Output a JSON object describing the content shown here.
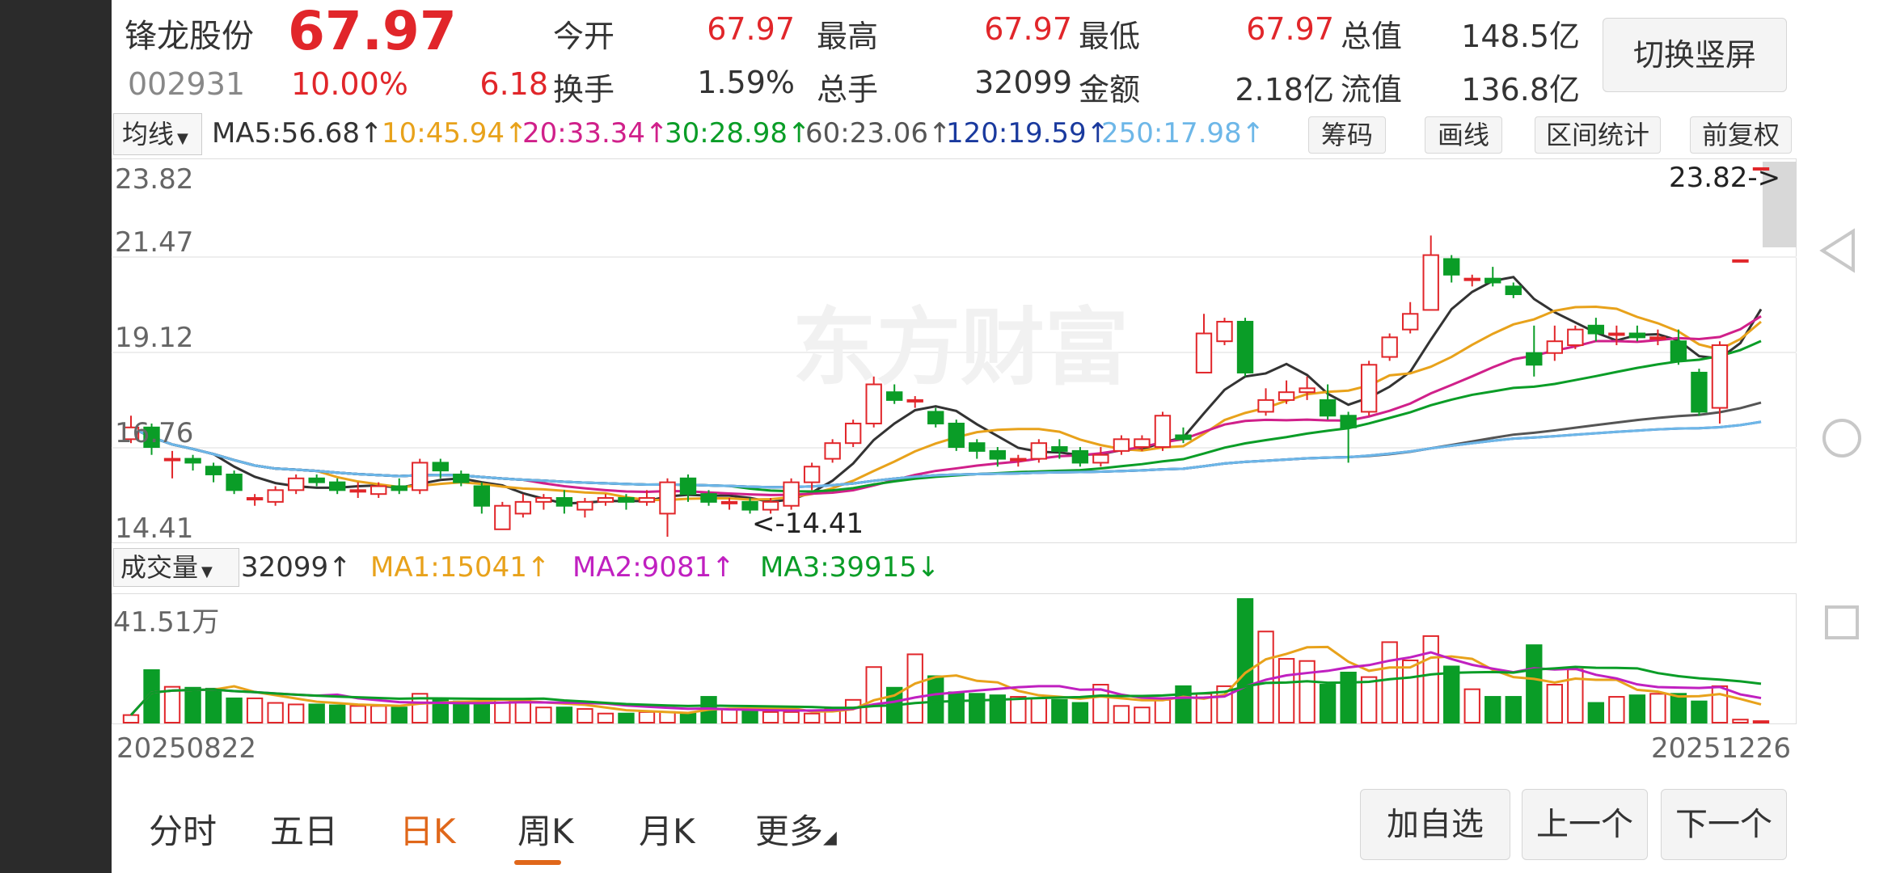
{
  "stock": {
    "name": "锋龙股份",
    "price": "67.97",
    "code": "002931",
    "change_pct": "10.00%",
    "change_amt": "6.18"
  },
  "stats": [
    {
      "label": "今开",
      "value": "67.97"
    },
    {
      "label": "最高",
      "value": "67.97"
    },
    {
      "label": "最低",
      "value": "67.97"
    },
    {
      "label": "总值",
      "value": "148.5亿"
    },
    {
      "label": "换手",
      "value": "1.59%"
    },
    {
      "label": "总手",
      "value": "32099"
    },
    {
      "label": "金额",
      "value": "2.18亿"
    },
    {
      "label": "流值",
      "value": "136.8亿"
    }
  ],
  "orientation_button": "切换竖屏",
  "ma_selector": "均线",
  "ma_legend": [
    {
      "text": "MA5:56.68↑",
      "color": "#333333"
    },
    {
      "text": "10:45.94↑",
      "color": "#e8a21b"
    },
    {
      "text": "20:33.34↑",
      "color": "#d0208a"
    },
    {
      "text": "30:28.98↑",
      "color": "#0a9d27"
    },
    {
      "text": "60:23.06↑",
      "color": "#555555"
    },
    {
      "text": "120:19.59↑",
      "color": "#1a3a9e"
    },
    {
      "text": "250:17.98↑",
      "color": "#6db7e8"
    }
  ],
  "tools": [
    "筹码",
    "画线",
    "区间统计",
    "前复权"
  ],
  "price_axis": [
    "23.82",
    "21.47",
    "19.12",
    "16.76",
    "14.41"
  ],
  "max_marker": "23.82->",
  "min_marker": "<-14.41",
  "watermark": "东方财富",
  "volume_selector": "成交量",
  "volume_legend": [
    {
      "text": "32099↑",
      "color": "#333333"
    },
    {
      "text": "MA1:15041↑",
      "color": "#e8a21b"
    },
    {
      "text": "MA2:9081↑",
      "color": "#c020c0"
    },
    {
      "text": "MA3:39915↓",
      "color": "#0a9d27"
    }
  ],
  "volume_axis_max": "41.51万",
  "date_start": "20250822",
  "date_end": "20251226",
  "tabs": [
    "分时",
    "五日",
    "日K",
    "周K",
    "月K",
    "更多"
  ],
  "active_tab": "日K",
  "actions": [
    "加自选",
    "上一个",
    "下一个"
  ],
  "colors": {
    "up": "#e1262a",
    "down": "#0a9d27",
    "accent": "#e0671a"
  },
  "chart_data": {
    "type": "candlestick",
    "ylim": [
      14.41,
      23.82
    ],
    "candles": [
      {
        "o": 16.9,
        "c": 17.2,
        "h": 17.5,
        "l": 16.8
      },
      {
        "o": 17.2,
        "c": 16.7,
        "h": 17.3,
        "l": 16.5
      },
      {
        "o": 16.4,
        "c": 16.4,
        "h": 16.6,
        "l": 15.9
      },
      {
        "o": 16.4,
        "c": 16.3,
        "h": 16.5,
        "l": 16.1
      },
      {
        "o": 16.2,
        "c": 16.0,
        "h": 16.3,
        "l": 15.8
      },
      {
        "o": 16.0,
        "c": 15.6,
        "h": 16.1,
        "l": 15.5
      },
      {
        "o": 15.4,
        "c": 15.4,
        "h": 15.5,
        "l": 15.2
      },
      {
        "o": 15.3,
        "c": 15.6,
        "h": 15.7,
        "l": 15.2
      },
      {
        "o": 15.6,
        "c": 15.9,
        "h": 16.0,
        "l": 15.5
      },
      {
        "o": 15.9,
        "c": 15.8,
        "h": 16.0,
        "l": 15.7
      },
      {
        "o": 15.8,
        "c": 15.6,
        "h": 15.9,
        "l": 15.5
      },
      {
        "o": 15.6,
        "c": 15.6,
        "h": 15.8,
        "l": 15.4
      },
      {
        "o": 15.5,
        "c": 15.7,
        "h": 15.8,
        "l": 15.4
      },
      {
        "o": 15.7,
        "c": 15.6,
        "h": 15.9,
        "l": 15.5
      },
      {
        "o": 15.6,
        "c": 16.3,
        "h": 16.4,
        "l": 15.5
      },
      {
        "o": 16.3,
        "c": 16.1,
        "h": 16.4,
        "l": 15.9
      },
      {
        "o": 16.0,
        "c": 15.8,
        "h": 16.1,
        "l": 15.7
      },
      {
        "o": 15.7,
        "c": 15.2,
        "h": 15.8,
        "l": 15.0
      },
      {
        "o": 14.6,
        "c": 15.2,
        "h": 15.3,
        "l": 14.6
      },
      {
        "o": 15.0,
        "c": 15.3,
        "h": 15.5,
        "l": 14.9
      },
      {
        "o": 15.3,
        "c": 15.4,
        "h": 15.5,
        "l": 15.1
      },
      {
        "o": 15.4,
        "c": 15.2,
        "h": 15.6,
        "l": 15.0
      },
      {
        "o": 15.1,
        "c": 15.3,
        "h": 15.4,
        "l": 14.9
      },
      {
        "o": 15.3,
        "c": 15.4,
        "h": 15.5,
        "l": 15.2
      },
      {
        "o": 15.4,
        "c": 15.3,
        "h": 15.5,
        "l": 15.1
      },
      {
        "o": 15.3,
        "c": 15.4,
        "h": 15.6,
        "l": 15.2
      },
      {
        "o": 15.0,
        "c": 15.8,
        "h": 15.9,
        "l": 14.41
      },
      {
        "o": 15.9,
        "c": 15.5,
        "h": 16.0,
        "l": 15.3
      },
      {
        "o": 15.5,
        "c": 15.3,
        "h": 15.6,
        "l": 15.2
      },
      {
        "o": 15.3,
        "c": 15.3,
        "h": 15.4,
        "l": 15.1
      },
      {
        "o": 15.3,
        "c": 15.1,
        "h": 15.4,
        "l": 15.0
      },
      {
        "o": 15.1,
        "c": 15.3,
        "h": 15.4,
        "l": 15.0
      },
      {
        "o": 15.2,
        "c": 15.8,
        "h": 15.9,
        "l": 15.1
      },
      {
        "o": 15.8,
        "c": 16.2,
        "h": 16.3,
        "l": 15.6
      },
      {
        "o": 16.4,
        "c": 16.8,
        "h": 16.9,
        "l": 16.3
      },
      {
        "o": 16.8,
        "c": 17.3,
        "h": 17.4,
        "l": 16.7
      },
      {
        "o": 17.3,
        "c": 18.3,
        "h": 18.5,
        "l": 17.2
      },
      {
        "o": 18.1,
        "c": 17.9,
        "h": 18.3,
        "l": 17.8
      },
      {
        "o": 17.9,
        "c": 17.9,
        "h": 18.0,
        "l": 17.7
      },
      {
        "o": 17.6,
        "c": 17.3,
        "h": 17.7,
        "l": 17.2
      },
      {
        "o": 17.3,
        "c": 16.7,
        "h": 17.4,
        "l": 16.6
      },
      {
        "o": 16.8,
        "c": 16.6,
        "h": 16.9,
        "l": 16.4
      },
      {
        "o": 16.6,
        "c": 16.4,
        "h": 16.7,
        "l": 16.2
      },
      {
        "o": 16.4,
        "c": 16.4,
        "h": 16.5,
        "l": 16.2
      },
      {
        "o": 16.4,
        "c": 16.8,
        "h": 16.9,
        "l": 16.3
      },
      {
        "o": 16.7,
        "c": 16.6,
        "h": 16.9,
        "l": 16.4
      },
      {
        "o": 16.6,
        "c": 16.3,
        "h": 16.7,
        "l": 16.2
      },
      {
        "o": 16.3,
        "c": 16.5,
        "h": 16.7,
        "l": 16.2
      },
      {
        "o": 16.6,
        "c": 16.9,
        "h": 17.0,
        "l": 16.5
      },
      {
        "o": 16.7,
        "c": 16.9,
        "h": 17.0,
        "l": 16.6
      },
      {
        "o": 16.7,
        "c": 17.5,
        "h": 17.6,
        "l": 16.6
      },
      {
        "o": 17.0,
        "c": 16.9,
        "h": 17.2,
        "l": 16.8
      },
      {
        "o": 18.6,
        "c": 19.6,
        "h": 20.1,
        "l": 18.6
      },
      {
        "o": 19.4,
        "c": 19.9,
        "h": 20.0,
        "l": 19.3
      },
      {
        "o": 19.9,
        "c": 18.6,
        "h": 20.0,
        "l": 18.5
      },
      {
        "o": 17.6,
        "c": 17.9,
        "h": 18.2,
        "l": 17.5
      },
      {
        "o": 17.9,
        "c": 18.1,
        "h": 18.4,
        "l": 17.8
      },
      {
        "o": 18.1,
        "c": 18.2,
        "h": 18.5,
        "l": 17.9
      },
      {
        "o": 17.9,
        "c": 17.5,
        "h": 18.3,
        "l": 17.4
      },
      {
        "o": 17.5,
        "c": 17.2,
        "h": 17.6,
        "l": 16.3
      },
      {
        "o": 17.6,
        "c": 18.8,
        "h": 18.9,
        "l": 17.5
      },
      {
        "o": 19.0,
        "c": 19.5,
        "h": 19.6,
        "l": 18.9
      },
      {
        "o": 19.7,
        "c": 20.1,
        "h": 20.4,
        "l": 19.6
      },
      {
        "o": 20.2,
        "c": 21.6,
        "h": 22.1,
        "l": 20.2
      },
      {
        "o": 21.5,
        "c": 21.1,
        "h": 21.6,
        "l": 20.9
      },
      {
        "o": 21.0,
        "c": 21.0,
        "h": 21.1,
        "l": 20.8
      },
      {
        "o": 21.0,
        "c": 20.9,
        "h": 21.3,
        "l": 20.8
      },
      {
        "o": 20.8,
        "c": 20.6,
        "h": 20.9,
        "l": 20.5
      },
      {
        "o": 19.1,
        "c": 18.8,
        "h": 19.8,
        "l": 18.5
      },
      {
        "o": 19.1,
        "c": 19.4,
        "h": 19.8,
        "l": 18.9
      },
      {
        "o": 19.3,
        "c": 19.7,
        "h": 19.8,
        "l": 19.2
      },
      {
        "o": 19.8,
        "c": 19.6,
        "h": 20.0,
        "l": 19.4
      },
      {
        "o": 19.6,
        "c": 19.6,
        "h": 19.8,
        "l": 19.3
      },
      {
        "o": 19.6,
        "c": 19.5,
        "h": 19.8,
        "l": 19.4
      },
      {
        "o": 19.5,
        "c": 19.5,
        "h": 19.7,
        "l": 19.3
      },
      {
        "o": 19.4,
        "c": 18.9,
        "h": 19.7,
        "l": 18.8
      },
      {
        "o": 18.6,
        "c": 17.6,
        "h": 18.7,
        "l": 17.5
      },
      {
        "o": 17.7,
        "c": 19.3,
        "h": 19.4,
        "l": 17.3
      },
      {
        "o": 21.47,
        "c": 21.47,
        "h": 21.47,
        "l": 21.47
      },
      {
        "o": 23.82,
        "c": 23.82,
        "h": 23.82,
        "l": 23.82
      }
    ],
    "volume_ylim": [
      0,
      41.51
    ],
    "volume": [
      2.5,
      17.3,
      11.8,
      11.5,
      11.2,
      8.0,
      8.0,
      6.5,
      6.0,
      6.0,
      5.7,
      5.5,
      5.5,
      5.0,
      9.5,
      7.5,
      7.0,
      6.5,
      7.5,
      7.5,
      5.0,
      5.0,
      4.5,
      3.0,
      3.0,
      3.5,
      3.5,
      3.0,
      8.5,
      4.5,
      4.0,
      3.5,
      3.5,
      3.0,
      4.5,
      7.5,
      18.3,
      11.5,
      22.5,
      15.3,
      10.0,
      9.5,
      9.0,
      8.5,
      8.0,
      7.5,
      6.5,
      12.5,
      5.5,
      5.0,
      7.5,
      12.0,
      9.5,
      12.0,
      40.7,
      30.0,
      21.0,
      20.3,
      12.5,
      16.5,
      15.0,
      26.5,
      20.5,
      28.5,
      18.5,
      11.0,
      8.5,
      8.5,
      25.5,
      12.5,
      17.5,
      6.5,
      8.5,
      9.0,
      9.5,
      9.5,
      7.0,
      12.0,
      1.0,
      0.5
    ],
    "x_start": "20250822",
    "x_end": "20251226"
  }
}
